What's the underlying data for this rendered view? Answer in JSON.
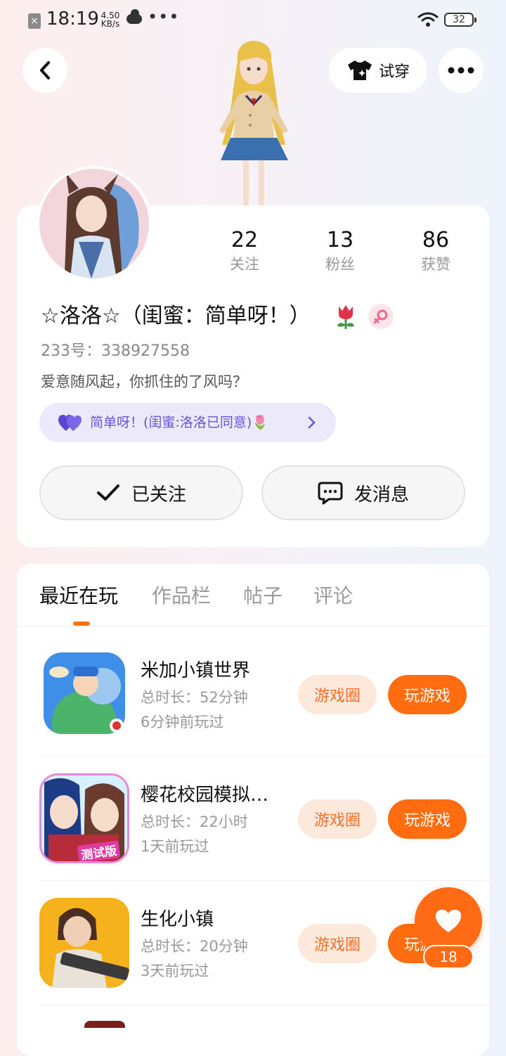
{
  "status_bar": {
    "time": "18:19",
    "speed": "4.50",
    "speed_unit": "KB/s",
    "battery": "32",
    "more": "•••"
  },
  "header": {
    "tryon_label": "试穿"
  },
  "profile": {
    "stats": [
      {
        "value": "22",
        "label": "关注"
      },
      {
        "value": "13",
        "label": "粉丝"
      },
      {
        "value": "86",
        "label": "获赞"
      }
    ],
    "nickname": "☆洛洛☆（闺蜜：简单呀！）",
    "user_id": "233号：338927558",
    "bio": "爱意随风起，你抓住的了风吗？",
    "bestie": "简单呀！(闺蜜:洛洛已同意)🌷",
    "follow_button": "已关注",
    "message_button": "发消息"
  },
  "tabs": [
    "最近在玩",
    "作品栏",
    "帖子",
    "评论"
  ],
  "games": [
    {
      "title": "米加小镇世界",
      "duration": "总时长：52分钟",
      "last_played": "6分钟前玩过",
      "circle_label": "游戏圈",
      "play_label": "玩游戏"
    },
    {
      "title": "樱花校园模拟…",
      "duration": "总时长：22小时",
      "last_played": "1天前玩过",
      "circle_label": "游戏圈",
      "play_label": "玩游戏",
      "icon_badge": "测试版"
    },
    {
      "title": "生化小镇",
      "duration": "总时长：20分钟",
      "last_played": "3天前玩过",
      "circle_label": "游戏圈",
      "play_label": "玩游戏"
    }
  ],
  "like_count": "18",
  "colors": {
    "accent": "#ff6d10",
    "accent_light": "#fde8dc",
    "bestie_bg": "#ece9fb",
    "bestie_text": "#6a52d8"
  },
  "icons": [
    "back-arrow-icon",
    "tshirt-icon",
    "more-icon",
    "tulip-icon",
    "female-icon",
    "heart-icon",
    "checkmark-icon",
    "chat-bubble-icon",
    "chevron-right-icon",
    "like-heart-icon"
  ]
}
